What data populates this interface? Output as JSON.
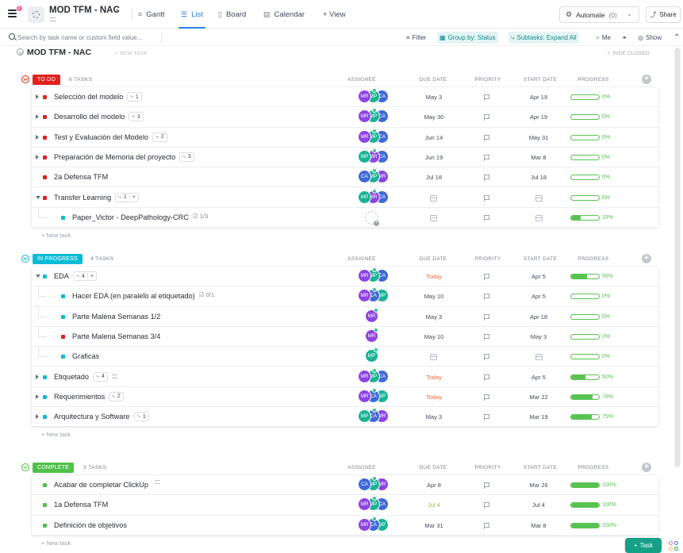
{
  "header": {
    "notification_count": "5",
    "title": "MOD TFM - NAC",
    "caret": "▾",
    "views": [
      {
        "label": "Gantt",
        "icon": "gantt-icon",
        "active": false
      },
      {
        "label": "List",
        "icon": "list-icon",
        "active": true
      },
      {
        "label": "Board",
        "icon": "board-icon",
        "active": false
      },
      {
        "label": "Calendar",
        "icon": "calendar-icon",
        "active": false
      }
    ],
    "add_view": "+ View",
    "automate_label": "Automate",
    "automate_count": "(0)",
    "share_label": "Share"
  },
  "filters": {
    "search_placeholder": "Search by task name or custom field value...",
    "filter": "Filter",
    "group_by": "Group by: Status",
    "subtasks": "Subtasks: Expand All",
    "me": "Me",
    "show": "Show"
  },
  "list": {
    "title": "MOD TFM - NAC",
    "new_task": "+ NEW TASK",
    "hide_closed": "HIDE CLOSED",
    "columns": {
      "assignee": "ASSIGNEE",
      "due": "DUE DATE",
      "priority": "PRIORITY",
      "start": "START DATE",
      "progress": "PROGRESS"
    },
    "add_task_link": "+ New task"
  },
  "colors": {
    "todo": "#e0211c",
    "in_progress": "#0bbcd6",
    "complete": "#4fc14a",
    "mr": "#8e44e0",
    "mp": "#1ab394",
    "ca": "#4069d4",
    "progress": "#59c352"
  },
  "groups": [
    {
      "status": "TO DO",
      "count": "6 TASKS",
      "color": "#e0211c",
      "tasks": [
        {
          "name": "Selección del modelo",
          "subtasks": "1",
          "expand": "right",
          "assignees": [
            "MR",
            "MP",
            "CA"
          ],
          "due": "May 3",
          "start": "Apr 19",
          "progress": 0,
          "progress_label": "0%"
        },
        {
          "name": "Desarrollo del modelo",
          "subtasks": "3",
          "expand": "right",
          "assignees": [
            "MR",
            "MP",
            "CA"
          ],
          "due": "May 30",
          "start": "Apr 19",
          "progress": 0,
          "progress_label": "0%"
        },
        {
          "name": "Test y Evaluación del Modelo",
          "subtasks": "2",
          "expand": "right",
          "assignees": [
            "MR",
            "MP",
            "CA"
          ],
          "due": "Jun 14",
          "start": "May 31",
          "progress": 0,
          "progress_label": "0%"
        },
        {
          "name": "Preparación de Memoria del proyecto",
          "subtasks": "3",
          "expand": "right",
          "assignees": [
            "MP",
            "MR",
            "CA"
          ],
          "due": "Jun 19",
          "start": "Mar 8",
          "progress": 0,
          "progress_label": "0%"
        },
        {
          "name": "2a Defensa TFM",
          "expand": "none",
          "assignees": [
            "CA",
            "MP",
            "MR"
          ],
          "due": "Jul 18",
          "start": "Jul 18",
          "progress": 0,
          "progress_label": "0%"
        },
        {
          "name": "Transfer Learning",
          "subtasks": "1",
          "plus": "+",
          "expand": "down",
          "assignees": [
            "MP",
            "MR",
            "CA"
          ],
          "due": "",
          "start": "",
          "progress": 0,
          "progress_label": "0%"
        },
        {
          "name": "Paper_Victor - DeepPathology-CRC",
          "sub": true,
          "checklist": "1/3",
          "color": "#0bbcd6",
          "assignees": [],
          "due": "",
          "start": "",
          "progress": 0.33,
          "progress_label": "33%"
        }
      ]
    },
    {
      "status": "IN PROGRESS",
      "count": "4 TASKS",
      "color": "#0bbcd6",
      "tasks": [
        {
          "name": "EDA",
          "subtasks": "4",
          "plus": "+",
          "expand": "down",
          "assignees": [
            "MR",
            "MP",
            "CA"
          ],
          "due": "Today",
          "due_style": "red",
          "start": "Apr 5",
          "progress": 0.56,
          "progress_label": "56%"
        },
        {
          "name": "Hacer EDA (en paralelo al etiquetado)",
          "sub": true,
          "checklist": "0/1",
          "color": "#0bbcd6",
          "assignees": [
            "MR",
            "CA",
            "MP"
          ],
          "due": "May 10",
          "start": "Apr 5",
          "progress": 0,
          "progress_label": "0%"
        },
        {
          "name": "Parte Malena Semanas 1/2",
          "sub": true,
          "color": "#0bbcd6",
          "assignees": [
            "MR"
          ],
          "due": "May 3",
          "start": "Apr 18",
          "progress": 0,
          "progress_label": "0%"
        },
        {
          "name": "Parte Malena Semanas 3/4",
          "sub": true,
          "color": "#e0211c",
          "assignees": [
            "MR"
          ],
          "due": "May 10",
          "start": "May 3",
          "progress": 0,
          "progress_label": "0%"
        },
        {
          "name": "Graficas",
          "sub": true,
          "color": "#0bbcd6",
          "assignees": [
            "MP"
          ],
          "due": "",
          "start": "",
          "progress": 0,
          "progress_label": "0%"
        },
        {
          "name": "Etiquetado",
          "subtasks": "4",
          "desc": true,
          "expand": "right",
          "assignees": [
            "MR",
            "MP",
            "CA"
          ],
          "due": "Today",
          "due_style": "red",
          "start": "Apr 5",
          "progress": 0.5,
          "progress_label": "50%"
        },
        {
          "name": "Requerimientos",
          "subtasks": "2",
          "expand": "right",
          "assignees": [
            "MR",
            "CA",
            "MP"
          ],
          "due": "Today",
          "due_style": "red",
          "start": "Mar 22",
          "progress": 0.78,
          "progress_label": "78%"
        },
        {
          "name": "Arquitectura y Software",
          "subtasks": "1",
          "expand": "right",
          "assignees": [
            "MP",
            "CA",
            "MR"
          ],
          "due": "May 3",
          "start": "Mar 19",
          "progress": 0.75,
          "progress_label": "75%"
        }
      ]
    },
    {
      "status": "COMPLETE",
      "count": "3 TASKS",
      "color": "#4fc14a",
      "tasks": [
        {
          "name": "Acabar de completar ClickUp",
          "desc": true,
          "expand": "none",
          "assignees": [
            "CA",
            "MP",
            "MR"
          ],
          "due": "Apr 8",
          "start": "Mar 26",
          "progress": 1,
          "progress_label": "100%"
        },
        {
          "name": "1a Defensa TFM",
          "expand": "none",
          "assignees": [
            "MR",
            "MP",
            "CA"
          ],
          "due": "Jul 4",
          "due_style": "green",
          "start": "Jul 4",
          "progress": 1,
          "progress_label": "100%"
        },
        {
          "name": "Definición de objetivos",
          "expand": "none",
          "assignees": [
            "MR",
            "CA",
            "MP"
          ],
          "due": "Mar 31",
          "start": "Mar 8",
          "progress": 1,
          "progress_label": "100%"
        }
      ]
    }
  ],
  "footer": {
    "task_button": "Task"
  }
}
